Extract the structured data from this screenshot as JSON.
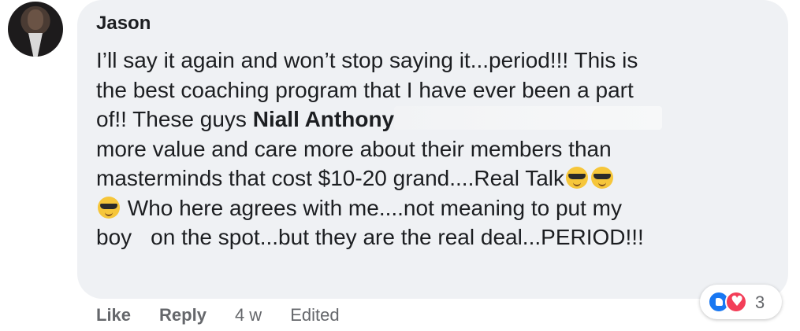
{
  "comment": {
    "author": "Jason",
    "lines": {
      "l1": "I’ll say it again and won’t stop saying it...period!!! This is",
      "l2": "the best coaching program that I have ever been a part",
      "l3a": "of!! These guys ",
      "l3_mention": "Niall Anthony",
      "l4": "more value and care more about their members than",
      "l5": "masterminds that cost $10-20 grand....Real Talk",
      "l6": " Who here agrees with me....not meaning to put my",
      "l7a": "boy",
      "l7b": "on the spot...but they are the real deal...PERIOD!!!"
    },
    "emoji_name": "smiling-face-with-sunglasses"
  },
  "actions": {
    "like": "Like",
    "reply": "Reply",
    "time": "4 w",
    "edited": "Edited"
  },
  "reactions": {
    "count": "3",
    "types": [
      "like-icon",
      "love-icon"
    ]
  },
  "colors": {
    "bubble": "#eff1f4",
    "text": "#1c1e21",
    "muted": "#65676b",
    "like": "#1877f2",
    "love": "#f33e58"
  }
}
